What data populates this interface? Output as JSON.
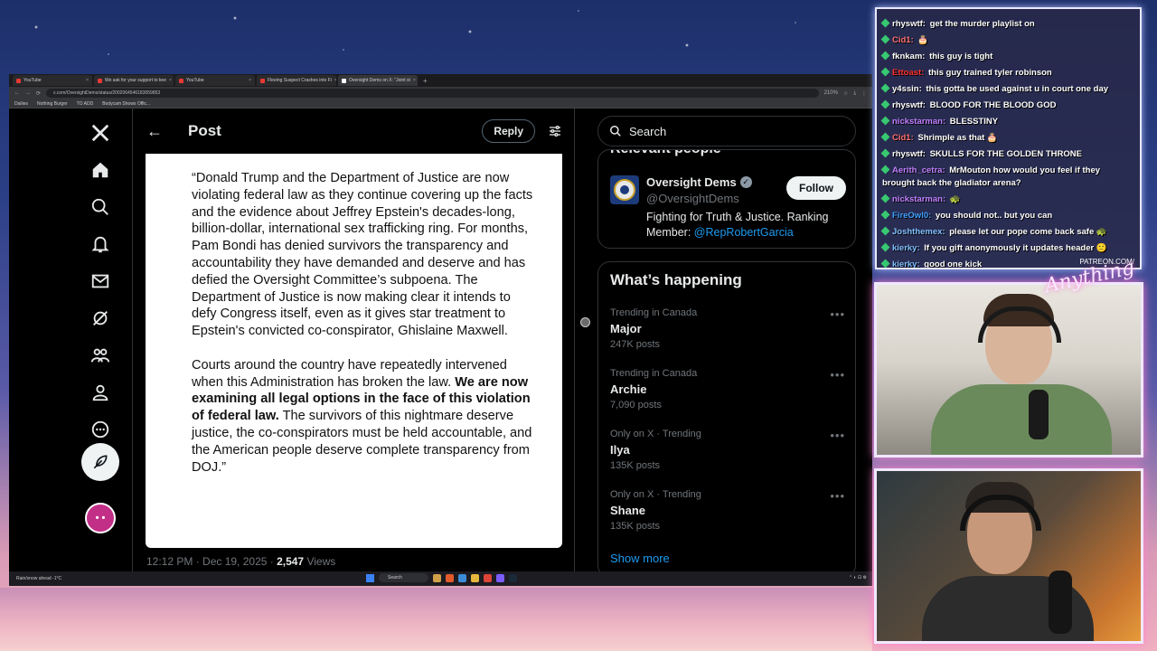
{
  "browser": {
    "tabs": [
      {
        "label": "YouTube",
        "active": false
      },
      {
        "label": "We ask for your support to kee",
        "active": false
      },
      {
        "label": "YouTube",
        "active": false
      },
      {
        "label": "Fleeing Suspect Crashes into Fi",
        "active": false
      },
      {
        "label": "Oversight Dems on X: \"Joint st",
        "active": true
      }
    ],
    "url": "x.com/OversightDems/status/2002064546183059853",
    "zoom": "210%",
    "bookmarks": [
      "Dailies",
      "Nothing Burger",
      "TO ADD",
      "Bodycam Shows Offic..."
    ]
  },
  "post": {
    "header_title": "Post",
    "reply_label": "Reply",
    "statement": {
      "p1": "“Donald Trump and the Department of Justice are now violating federal law as they continue covering up the facts and the evidence about Jeffrey Epstein's decades-long, billion-dollar, international sex trafficking ring. For months, Pam Bondi has denied survivors the transparency and accountability they have demanded and deserve and has defied the Oversight Committee’s subpoena. The Department of Justice is now making clear it intends to defy Congress itself, even as it gives star treatment to Epstein's convicted co-conspirator, Ghislaine Maxwell.",
      "p2_a": "Courts around the country have repeatedly intervened when this Administration has broken the law. ",
      "p2_bold": "We are now examining all legal options in the face of this violation of federal law.",
      "p2_b": " The survivors of this nightmare deserve justice, the co-conspirators must be held accountable, and the American people deserve complete transparency from DOJ.”"
    },
    "meta_time": "12:12 PM · Dec 19, 2025 · ",
    "meta_views": "2,547",
    "meta_views_label": " Views"
  },
  "sidebar": {
    "search_placeholder": "Search",
    "relevant_title": "Relevant people",
    "account": {
      "name": "Oversight Dems",
      "handle": "@OversightDems",
      "follow_label": "Follow",
      "bio": "Fighting for Truth & Justice. Ranking Member: ",
      "bio_link": "@RepRobertGarcia"
    },
    "happening_title": "What’s happening",
    "trends": [
      {
        "context": "Trending in Canada",
        "name": "Major",
        "count": "247K posts"
      },
      {
        "context": "Trending in Canada",
        "name": "Archie",
        "count": "7,090 posts"
      },
      {
        "context": "Only on X · Trending",
        "name": "Ilya",
        "count": "135K posts"
      },
      {
        "context": "Only on X · Trending",
        "name": "Shane",
        "count": "135K posts"
      }
    ],
    "show_more": "Show more"
  },
  "taskbar": {
    "weather": "Rain/snow ahead",
    "temp": "-1°C",
    "search": "Search"
  },
  "chat": {
    "messages": [
      {
        "user": "rhyswtf:",
        "text": "get the murder playlist on",
        "color": "#ffffff"
      },
      {
        "user": "Cid1:",
        "text": "🎂",
        "color": "#ff7070"
      },
      {
        "user": "fknkam:",
        "text": "this guy is tight",
        "color": "#ffffff"
      },
      {
        "user": "Ettoast:",
        "text": "this guy trained tyler robinson",
        "color": "#ff3030"
      },
      {
        "user": "y4ssin:",
        "text": "this gotta be used against u in court one day",
        "color": "#ffffff"
      },
      {
        "user": "rhyswtf:",
        "text": "BLOOD FOR THE BLOOD GOD",
        "color": "#ffffff"
      },
      {
        "user": "nickstarman:",
        "text": "BLESSTINY",
        "color": "#c080ff"
      },
      {
        "user": "Cid1:",
        "text": "Shrimple as that 🎂",
        "color": "#ff7070"
      },
      {
        "user": "rhyswtf:",
        "text": "SKULLS FOR THE GOLDEN THRONE",
        "color": "#ffffff"
      },
      {
        "user": "Aerith_cetra:",
        "text": "MrMouton how would you feel if they brought back the gladiator arena?",
        "color": "#c080ff"
      },
      {
        "user": "nickstarman:",
        "text": "🐢",
        "color": "#c080ff"
      },
      {
        "user": "FireOwl0:",
        "text": "you should not.. but you can",
        "color": "#40a0ff"
      },
      {
        "user": "Joshthemex:",
        "text": "please let our pope come back safe 🐢",
        "color": "#80c0ff"
      },
      {
        "user": "kierky:",
        "text": "If you gift anonymously it updates header 🙂",
        "color": "#80c0ff"
      },
      {
        "user": "kierky:",
        "text": "good one kick",
        "color": "#80c0ff"
      }
    ],
    "footer": "PATREON.COM/"
  }
}
